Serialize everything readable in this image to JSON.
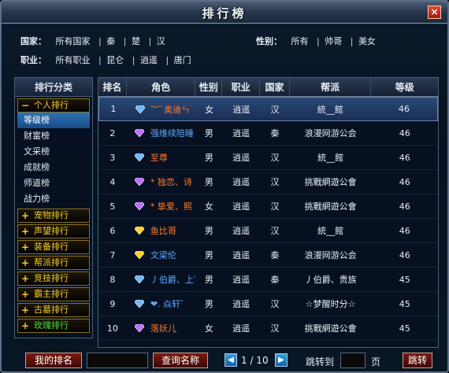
{
  "window": {
    "title": "排行榜",
    "close_label": "×"
  },
  "filters": {
    "country_label": "国家：",
    "country_options": [
      "所有国家",
      "秦",
      "楚",
      "汉"
    ],
    "gender_label": "性别：",
    "gender_options": [
      "所有",
      "帅哥",
      "美女"
    ],
    "job_label": "职业：",
    "job_options": [
      "所有职业",
      "昆仑",
      "逍遥",
      "唐门"
    ]
  },
  "sidebar": {
    "title": "排行分类",
    "expanded_category": {
      "label": "个人排行",
      "toggle": "−"
    },
    "sub_items": [
      "等级榜",
      "财富榜",
      "文采榜",
      "成就榜",
      "师道榜",
      "战力榜"
    ],
    "selected_sub_item": "等级榜",
    "collapsed_categories": [
      {
        "label": "宠物排行",
        "toggle": "+"
      },
      {
        "label": "声望排行",
        "toggle": "+"
      },
      {
        "label": "装备排行",
        "toggle": "+"
      },
      {
        "label": "帮派排行",
        "toggle": "+"
      },
      {
        "label": "竞技排行",
        "toggle": "+"
      },
      {
        "label": "霸主排行",
        "toggle": "+"
      },
      {
        "label": "古墓排行",
        "toggle": "+"
      },
      {
        "label": "玫瑰排行",
        "toggle": "+"
      }
    ]
  },
  "table": {
    "headers": [
      "排名",
      "角色",
      "性别",
      "职业",
      "国家",
      "帮派",
      "等级"
    ],
    "rows": [
      {
        "rank": "1",
        "gem": "blue-gem",
        "name": "︶ˋ奥迪ㄣ",
        "name_color": "#ff7a2b",
        "gender": "女",
        "job": "逍遥",
        "country": "汉",
        "guild": "統__館",
        "level": "46"
      },
      {
        "rank": "2",
        "gem": "purple-gem",
        "name": "强维续陪睡",
        "name_color": "#5fa8ff",
        "gender": "男",
        "job": "逍遥",
        "country": "秦",
        "guild": "浪漫网游公会",
        "level": "46"
      },
      {
        "rank": "3",
        "gem": "blue-gem",
        "name": "至尊",
        "name_color": "#ff7a2b",
        "gender": "男",
        "job": "逍遥",
        "country": "汉",
        "guild": "統__館",
        "level": "46"
      },
      {
        "rank": "4",
        "gem": "purple-gem",
        "name": "* 独恋、诗",
        "name_color": "#ff7a2b",
        "gender": "男",
        "job": "逍遥",
        "country": "汉",
        "guild": "挑戰網遊公會",
        "level": "46"
      },
      {
        "rank": "5",
        "gem": "purple-gem",
        "name": "* 挚爱、熙",
        "name_color": "#ff7a2b",
        "gender": "女",
        "job": "逍遥",
        "country": "汉",
        "guild": "挑戰網遊公會",
        "level": "46"
      },
      {
        "rank": "6",
        "gem": "yellow-gem",
        "name": "鱼比哥",
        "name_color": "#ff7a2b",
        "gender": "男",
        "job": "逍遥",
        "country": "汉",
        "guild": "統__館",
        "level": "46"
      },
      {
        "rank": "7",
        "gem": "yellow-gem",
        "name": "文梁伦",
        "name_color": "#5fa8ff",
        "gender": "男",
        "job": "逍遥",
        "country": "秦",
        "guild": "浪漫网游公会",
        "level": "46"
      },
      {
        "rank": "8",
        "gem": "blue-gem",
        "name": "丿伯爵、上官",
        "name_color": "#5fa8ff",
        "gender": "男",
        "job": "逍遥",
        "country": "秦",
        "guild": "丿伯爵、贵族",
        "level": "45"
      },
      {
        "rank": "9",
        "gem": "blue-gem",
        "name": "❤. 焱轩゛",
        "name_color": "#5fa8ff",
        "gender": "男",
        "job": "逍遥",
        "country": "汉",
        "guild": "☆梦醒时分☆",
        "level": "45"
      },
      {
        "rank": "10",
        "gem": "purple-gem",
        "name": "落妖儿",
        "name_color": "#ff7a2b",
        "gender": "女",
        "job": "逍遥",
        "country": "汉",
        "guild": "挑戰網遊公會",
        "level": "45"
      }
    ],
    "selected_rank": "1"
  },
  "footer": {
    "my_rank_button": "我的排名",
    "name_input_value": "",
    "query_button": "查询名称",
    "page_indicator": "1 / 10",
    "jump_label": "跳转到",
    "page_input_value": "",
    "page_suffix": "页",
    "jump_button": "跳转"
  },
  "colors": {
    "gem_blue": "#6fb7ff",
    "gem_purple": "#c06cff",
    "gem_yellow": "#ffd12a",
    "category_text": "#f2cd29",
    "category_text_green": "#48e13b"
  }
}
